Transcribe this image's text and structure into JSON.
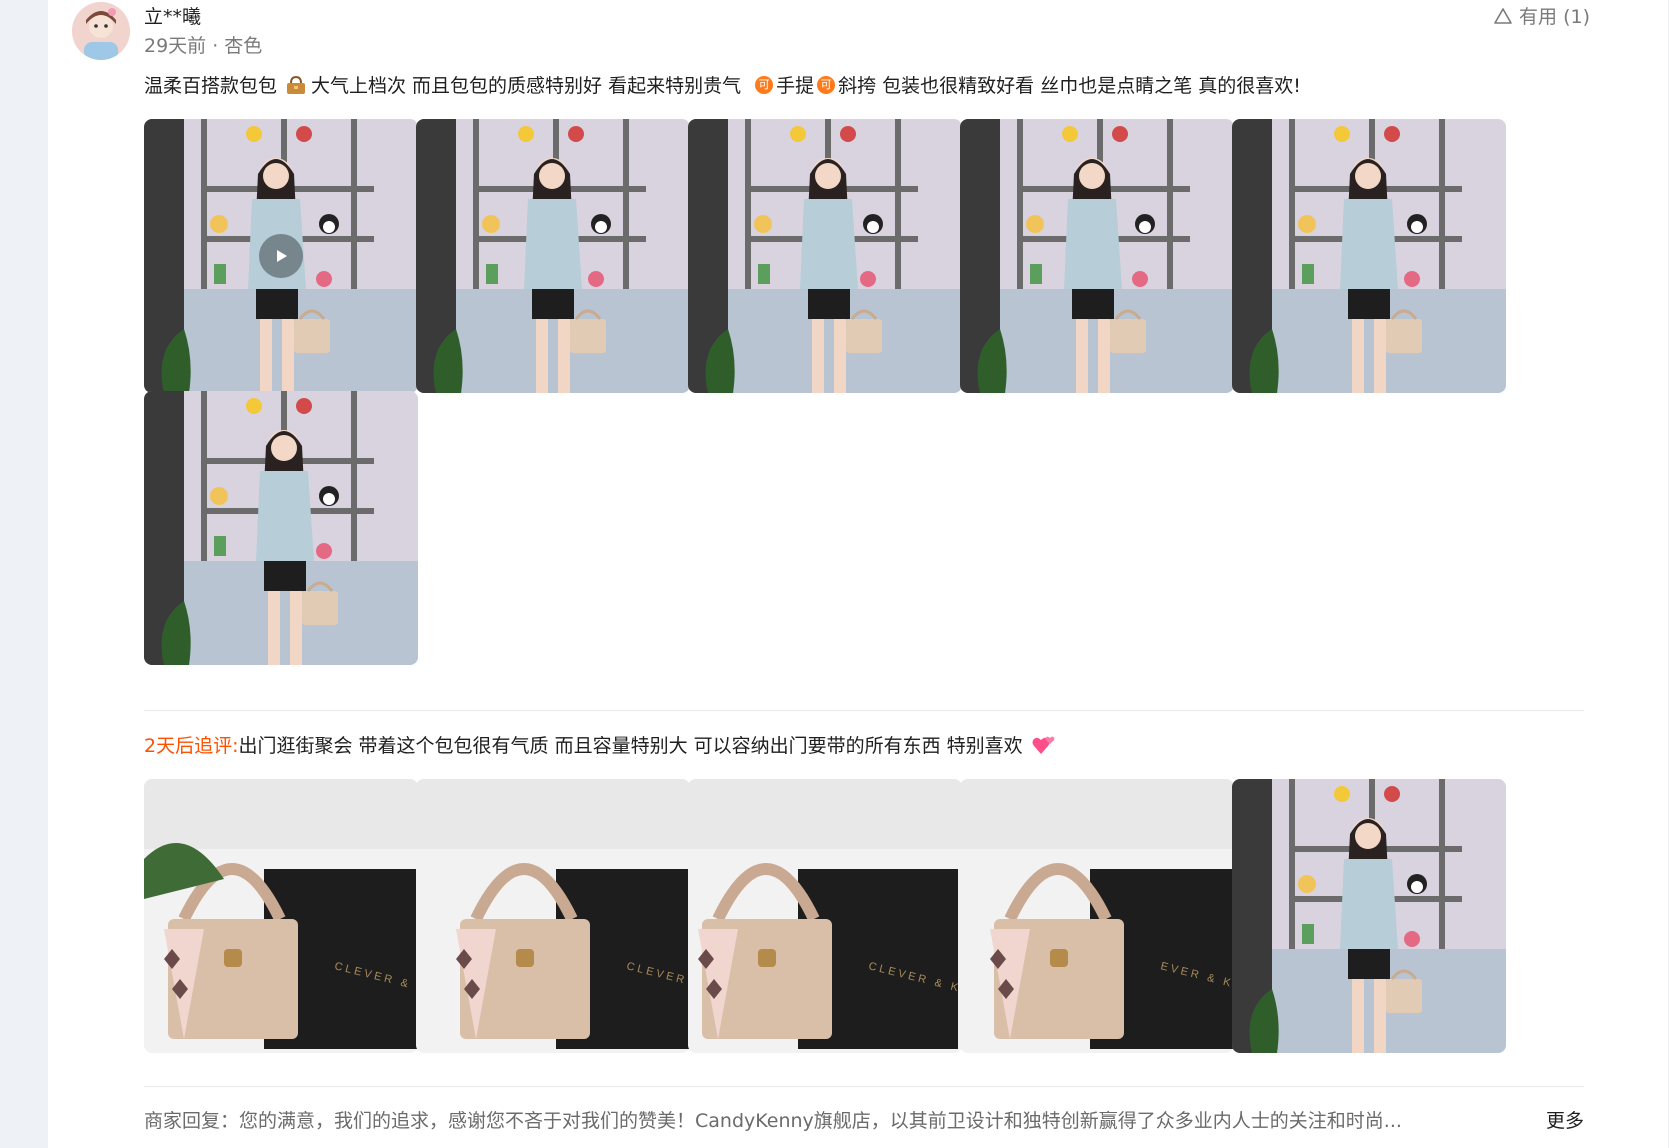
{
  "review": {
    "username": "立**曦",
    "meta": "29天前 · 杏色",
    "useful_label": "有用 (1)",
    "text_part1": "温柔百搭款包包",
    "text_part2": "大气上档次 而且包包的质感特别好 看起来特别贵气",
    "text_part3": "手提",
    "text_part4": "斜挎 包装也很精致好看 丝巾也是点睛之笔 真的很喜欢!",
    "ke_badge": "可",
    "photos": [
      {
        "kind": "video",
        "label": "model"
      },
      {
        "kind": "image",
        "label": "model"
      },
      {
        "kind": "image",
        "label": "model"
      },
      {
        "kind": "image",
        "label": "model"
      },
      {
        "kind": "image",
        "label": "model"
      },
      {
        "kind": "image",
        "label": "model"
      }
    ]
  },
  "followup": {
    "label": "2天后追评:",
    "text": "出门逛街聚会 带着这个包包很有气质 而且容量特别大 可以容纳出门要带的所有东西 特别喜欢",
    "photos": [
      {
        "kind": "image",
        "label": "bag",
        "box_text": "CLEVER & KE"
      },
      {
        "kind": "image",
        "label": "bag",
        "box_text": "CLEVER & KETC"
      },
      {
        "kind": "image",
        "label": "bag",
        "box_text": "CLEVER & KETCH"
      },
      {
        "kind": "image",
        "label": "bag",
        "box_text": "EVER & KET"
      },
      {
        "kind": "image",
        "label": "model"
      }
    ]
  },
  "merchant_reply": {
    "text": "商家回复：您的满意，我们的追求，感谢您不吝于对我们的赞美！CandyKenny旗舰店，以其前卫设计和独特创新赢得了众多业内人士的关注和时尚...",
    "more_label": "更多"
  },
  "colors": {
    "accent": "#ff5000",
    "badge": "#ff7a1a",
    "meta_text": "#7a7a7a"
  }
}
